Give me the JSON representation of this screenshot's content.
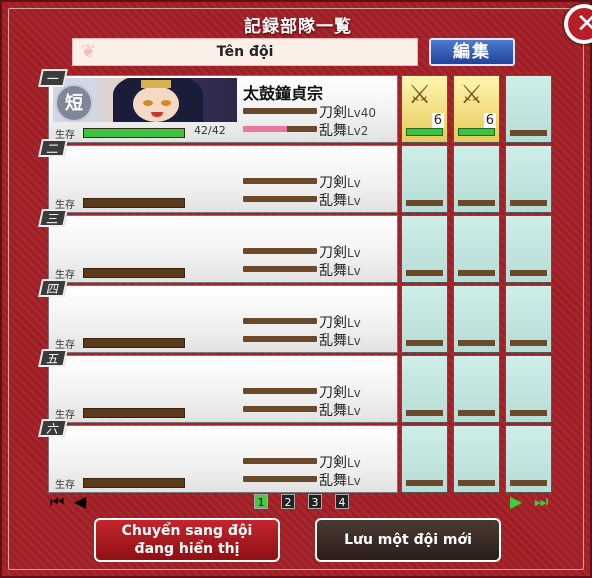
{
  "window": {
    "title": "記録部隊一覧",
    "close_icon": "close-icon"
  },
  "team_name": {
    "value": "Tên đội",
    "feather_icon": "feather-icon"
  },
  "edit_button": "編集",
  "labels": {
    "live": "生存",
    "sword": "刀剣",
    "lv": "Lv",
    "ranbu": "乱舞"
  },
  "rows": [
    {
      "num": "一",
      "name": "太鼓鐘貞宗",
      "type_badge": "短",
      "hp_text": "42/42",
      "hp_pct": 100,
      "sword_lv": "40",
      "ranbu_lv": "2",
      "ranbu_pct": 60,
      "slots": [
        {
          "equipped": true,
          "count": "6",
          "icon": "soldier-icon"
        },
        {
          "equipped": true,
          "count": "6",
          "icon": "soldier-icon"
        },
        {
          "equipped": false
        }
      ]
    },
    {
      "num": "二",
      "name": "",
      "hp_text": "",
      "sword_lv": "",
      "ranbu_lv": ""
    },
    {
      "num": "三",
      "name": "",
      "hp_text": "",
      "sword_lv": "",
      "ranbu_lv": ""
    },
    {
      "num": "四",
      "name": "",
      "hp_text": "",
      "sword_lv": "",
      "ranbu_lv": ""
    },
    {
      "num": "五",
      "name": "",
      "hp_text": "",
      "sword_lv": "",
      "ranbu_lv": ""
    },
    {
      "num": "六",
      "name": "",
      "hp_text": "",
      "sword_lv": "",
      "ranbu_lv": ""
    }
  ],
  "pager": {
    "pages": [
      "1",
      "2",
      "3",
      "4"
    ],
    "active": "1"
  },
  "buttons": {
    "switch": "Chuyển sang đội\nđang hiển thị",
    "save": "Lưu một đội mới"
  },
  "colors": {
    "frame": "#a9262d",
    "hp": "#3fc141",
    "ranbu": "#e87aa0",
    "accent_blue": "#20439c"
  }
}
